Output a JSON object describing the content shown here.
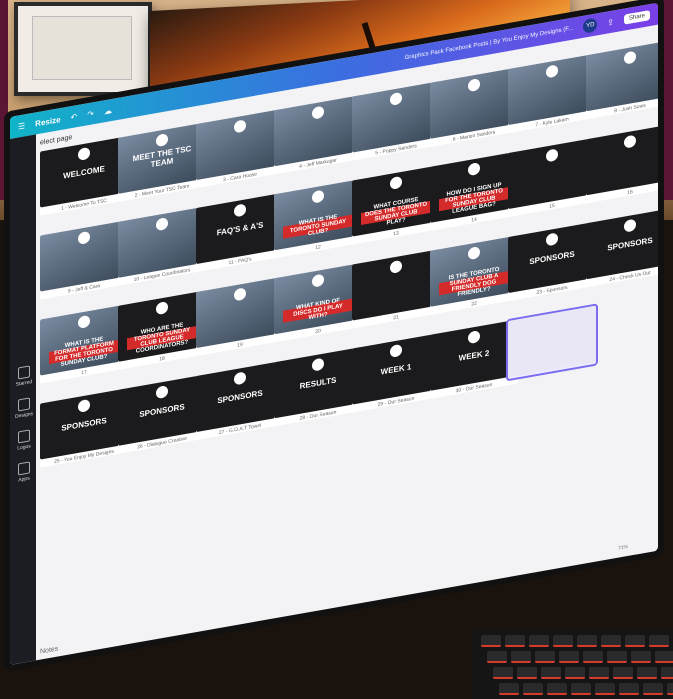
{
  "app": {
    "toolbar": {
      "resize_label": "Resize",
      "title": "Graphics Pack Facebook Posts | By You Enjoy My Designs (F...",
      "avatar_initials": "YD",
      "share_label": "Share"
    },
    "sidebar": {
      "items": [
        {
          "label": "Starred",
          "icon": "star-icon"
        },
        {
          "label": "Designs",
          "icon": "designs-icon"
        },
        {
          "label": "Logos",
          "icon": "logo-icon"
        },
        {
          "label": "Apps",
          "icon": "apps-icon"
        }
      ]
    },
    "select_page_label": "elect page",
    "notes_label": "Notes",
    "zoom_label": "71%",
    "pages": [
      {
        "caption": "1 - Welcome To TSC",
        "text": "WELCOME",
        "kind": "dark"
      },
      {
        "caption": "2 - Meet Your TSC Team",
        "text": "MEET THE TSC TEAM",
        "kind": "photo"
      },
      {
        "caption": "3 - Cara Hoose",
        "text": "",
        "kind": "photo"
      },
      {
        "caption": "4 - Jeff Markogar",
        "text": "",
        "kind": "photo"
      },
      {
        "caption": "5 - Poppy Sanders",
        "text": "",
        "kind": "photo"
      },
      {
        "caption": "6 - Marlon Sanders",
        "text": "",
        "kind": "photo"
      },
      {
        "caption": "7 - Kyle Lakam",
        "text": "",
        "kind": "photo"
      },
      {
        "caption": "8 - Josh Sows",
        "text": "",
        "kind": "photo"
      },
      {
        "caption": "9 - Jeff & Cara",
        "text": "",
        "kind": "photo"
      },
      {
        "caption": "10 - League Coordinators",
        "text": "",
        "kind": "photo"
      },
      {
        "caption": "11 - FAQ's",
        "text": "FAQ'S & A'S",
        "kind": "dark"
      },
      {
        "caption": "12",
        "text": "WHAT IS THE TORONTO SUNDAY CLUB?",
        "kind": "photo"
      },
      {
        "caption": "13",
        "text": "WHAT COURSE DOES THE TORONTO SUNDAY CLUB PLAY?",
        "kind": "dark"
      },
      {
        "caption": "14",
        "text": "HOW DO I SIGN UP FOR THE TORONTO SUNDAY CLUB LEAGUE BAG?",
        "kind": "dark"
      },
      {
        "caption": "15",
        "text": "",
        "kind": "dark"
      },
      {
        "caption": "16",
        "text": "",
        "kind": "dark"
      },
      {
        "caption": "17",
        "text": "WHAT IS THE FORMAT PLATFORM FOR THE TORONTO SUNDAY CLUB?",
        "kind": "photo"
      },
      {
        "caption": "18",
        "text": "WHO ARE THE TORONTO SUNDAY CLUB LEAGUE COORDINATORS?",
        "kind": "dark"
      },
      {
        "caption": "19",
        "text": "",
        "kind": "photo"
      },
      {
        "caption": "20",
        "text": "WHAT KIND OF DISCS DO I PLAY WITH?",
        "kind": "photo"
      },
      {
        "caption": "21",
        "text": "",
        "kind": "dark"
      },
      {
        "caption": "22",
        "text": "IS THE TORONTO SUNDAY CLUB A FRIENDLY DOG FRIENDLY?",
        "kind": "photo"
      },
      {
        "caption": "23 - Sponsors",
        "text": "SPONSORS",
        "kind": "dark"
      },
      {
        "caption": "24 - Check Us Out",
        "text": "SPONSORS",
        "kind": "dark"
      },
      {
        "caption": "25 - You Enjoy My Designs",
        "text": "SPONSORS",
        "kind": "dark"
      },
      {
        "caption": "26 - Dialogue Creative",
        "text": "SPONSORS",
        "kind": "dark"
      },
      {
        "caption": "27 - G.O.A.T Towel",
        "text": "SPONSORS",
        "kind": "dark"
      },
      {
        "caption": "28 - Our Season",
        "text": "RESULTS",
        "kind": "dark"
      },
      {
        "caption": "29 - Our Season",
        "text": "WEEK 1",
        "kind": "dark"
      },
      {
        "caption": "30 - Our Season",
        "text": "WEEK 2",
        "kind": "dark"
      },
      {
        "caption": "",
        "text": "",
        "kind": "selected"
      }
    ]
  }
}
